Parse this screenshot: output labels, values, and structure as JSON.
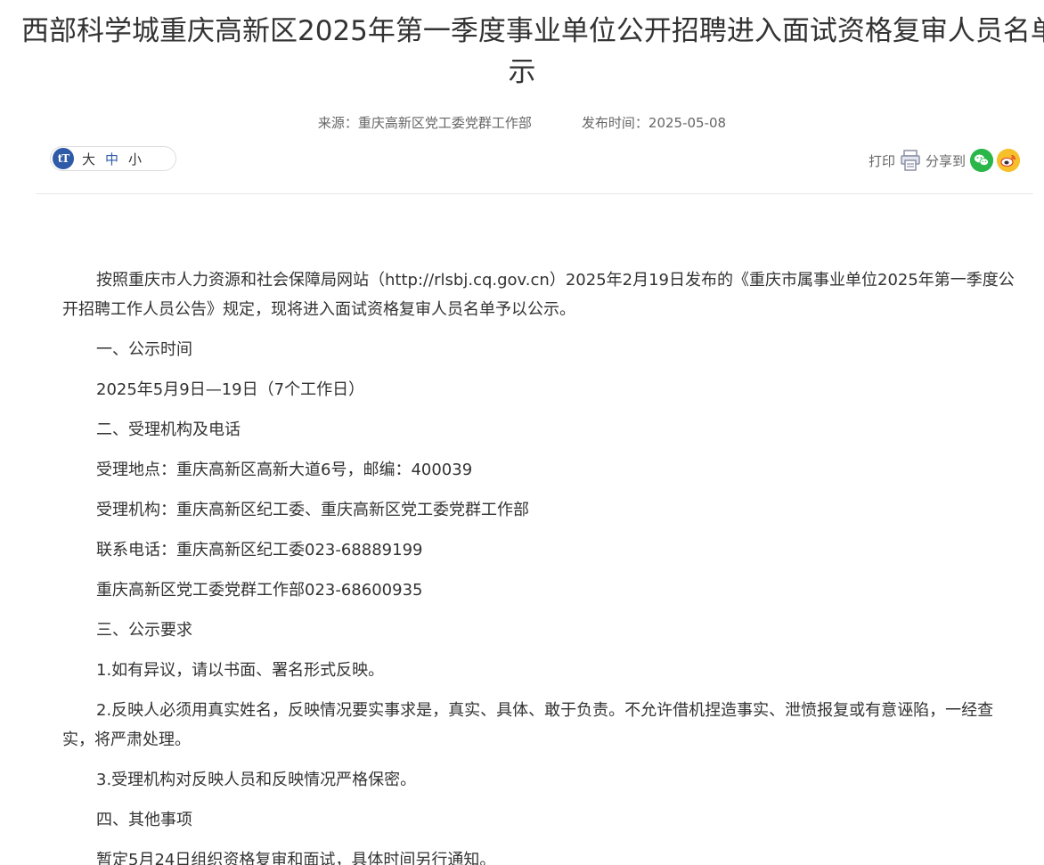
{
  "article": {
    "title_line1": "西部科学城重庆高新区2025年第一季度事业单位公开招聘进入面试资格复审人员名单公",
    "title_line2": "示",
    "source_label": "来源：",
    "source": "重庆高新区党工委党群工作部",
    "date_label": "发布时间：",
    "date": "2025-05-08"
  },
  "font_size": {
    "icon": "tT",
    "options": [
      "大",
      "中",
      "小"
    ],
    "selected": "中"
  },
  "share": {
    "print_label": "打印",
    "share_label": "分享到",
    "icons": [
      "print-icon",
      "wechat-icon",
      "weibo-icon"
    ]
  },
  "colors": {
    "accent": "#2e5aa7",
    "wechat": "#2ab649",
    "weibo": "#f6c02a"
  },
  "body": [
    "按照重庆市人力资源和社会保障局网站（http://rlsbj.cq.gov.cn）2025年2月19日发布的《重庆市属事业单位2025年第一季度公开招聘工作人员公告》规定，现将进入面试资格复审人员名单予以公示。",
    "一、公示时间",
    "2025年5月9日—19日（7个工作日）",
    "二、受理机构及电话",
    "受理地点：重庆高新区高新大道6号，邮编：400039",
    "受理机构：重庆高新区纪工委、重庆高新区党工委党群工作部",
    "联系电话：重庆高新区纪工委023-68889199",
    "重庆高新区党工委党群工作部023-68600935",
    "三、公示要求",
    "1.如有异议，请以书面、署名形式反映。",
    "2.反映人必须用真实姓名，反映情况要实事求是，真实、具体、敢于负责。不允许借机捏造事实、泄愤报复或有意诬陷，一经查实，将严肃处理。",
    "3.受理机构对反映人员和反映情况严格保密。",
    "四、其他事项",
    "暂定5月24日组织资格复审和面试，具体时间另行通知。"
  ]
}
